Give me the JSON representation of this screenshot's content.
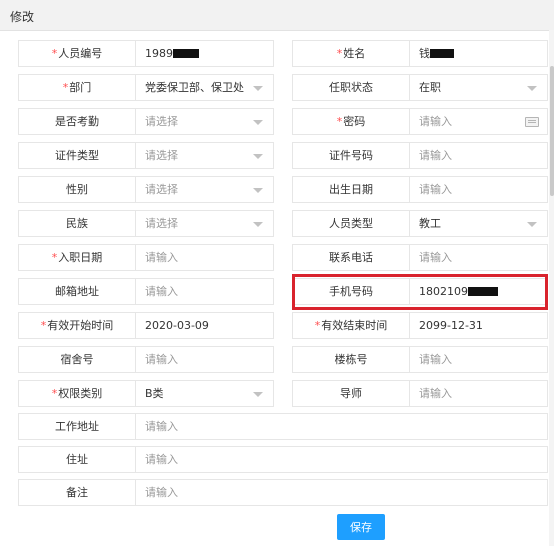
{
  "dialog": {
    "title": "修改"
  },
  "fields": {
    "staff_no": {
      "label": "人员编号",
      "required": "*",
      "value": "1989"
    },
    "name": {
      "label": "姓名",
      "required": "*",
      "value": "钱"
    },
    "department": {
      "label": "部门",
      "required": "*",
      "value": "党委保卫部、保卫处"
    },
    "employment_status": {
      "label": "任职状态",
      "value": "在职"
    },
    "attendance": {
      "label": "是否考勤",
      "placeholder": "请选择"
    },
    "password": {
      "label": "密码",
      "required": "*",
      "placeholder": "请输入"
    },
    "id_type": {
      "label": "证件类型",
      "placeholder": "请选择"
    },
    "id_number": {
      "label": "证件号码",
      "placeholder": "请输入"
    },
    "gender": {
      "label": "性别",
      "placeholder": "请选择"
    },
    "birth_date": {
      "label": "出生日期",
      "placeholder": "请输入"
    },
    "ethnicity": {
      "label": "民族",
      "placeholder": "请选择"
    },
    "staff_type": {
      "label": "人员类型",
      "value": "教工"
    },
    "hire_date": {
      "label": "入职日期",
      "required": "*",
      "placeholder": "请输入"
    },
    "phone": {
      "label": "联系电话",
      "placeholder": "请输入"
    },
    "email": {
      "label": "邮箱地址",
      "placeholder": "请输入"
    },
    "mobile": {
      "label": "手机号码",
      "value": "1802109"
    },
    "valid_start": {
      "label": "有效开始时间",
      "required": "*",
      "value": "2020-03-09"
    },
    "valid_end": {
      "label": "有效结束时间",
      "required": "*",
      "value": "2099-12-31"
    },
    "dorm_no": {
      "label": "宿舍号",
      "placeholder": "请输入"
    },
    "building_no": {
      "label": "楼栋号",
      "placeholder": "请输入"
    },
    "permission_type": {
      "label": "权限类别",
      "required": "*",
      "value": "B类"
    },
    "advisor": {
      "label": "导师",
      "placeholder": "请输入"
    },
    "work_address": {
      "label": "工作地址",
      "placeholder": "请输入"
    },
    "address": {
      "label": "住址",
      "placeholder": "请输入"
    },
    "remarks": {
      "label": "备注",
      "placeholder": "请输入"
    }
  },
  "actions": {
    "save_label": "保存"
  },
  "colors": {
    "primary": "#1e9fff",
    "required": "#ff4d4f",
    "highlight": "#d9232d"
  },
  "icons": {
    "select": "chevron-down-icon",
    "keyboard": "keyboard-icon"
  }
}
